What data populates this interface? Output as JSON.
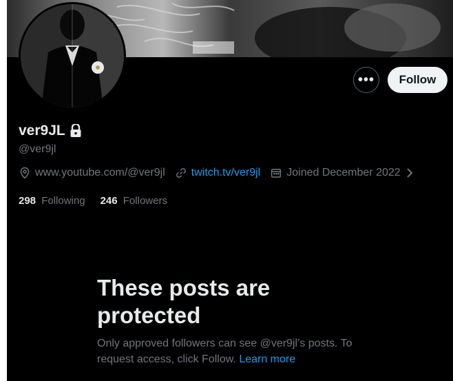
{
  "profile": {
    "display_name": "ver9JL",
    "handle": "@ver9jl",
    "website": "www.youtube.com/@ver9jl",
    "link": "twitch.tv/ver9jl",
    "joined": "Joined December 2022",
    "following_count": "298",
    "following_label": "Following",
    "followers_count": "246",
    "followers_label": "Followers"
  },
  "actions": {
    "more_label": "•••",
    "follow_label": "Follow"
  },
  "protected": {
    "title": "These posts are protected",
    "body": "Only approved followers can see @ver9jl’s posts. To request access, click Follow.",
    "learn_more": "Learn more"
  },
  "icons": {
    "lock": "lock-icon",
    "location": "location-icon",
    "link": "link-icon",
    "calendar": "calendar-icon",
    "more": "more-icon",
    "chevron": "chevron-right-icon"
  },
  "colors": {
    "background": "#000000",
    "text_primary": "#e7e9ea",
    "text_secondary": "#71767b",
    "accent": "#1d9bf0",
    "follow_bg": "#eff3f4"
  }
}
